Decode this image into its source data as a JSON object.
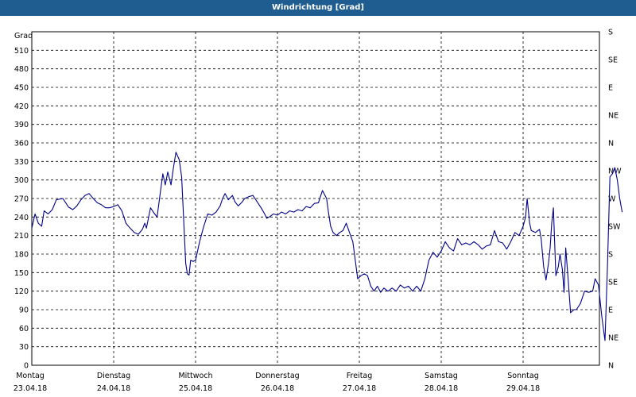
{
  "window": {
    "title": "Windrichtung [Grad]"
  },
  "chart_data": {
    "type": "line",
    "title": "Windrichtung [Grad]",
    "ylabel": "Grad",
    "ylim": [
      0,
      540
    ],
    "grid": true,
    "y_ticks": [
      0,
      30,
      60,
      90,
      120,
      150,
      180,
      210,
      240,
      270,
      300,
      330,
      360,
      390,
      420,
      450,
      480,
      510
    ],
    "right_ticks": [
      {
        "deg": 0,
        "label": "N"
      },
      {
        "deg": 45,
        "label": "NE"
      },
      {
        "deg": 90,
        "label": "E"
      },
      {
        "deg": 135,
        "label": "SE"
      },
      {
        "deg": 180,
        "label": "S"
      },
      {
        "deg": 225,
        "label": "SW"
      },
      {
        "deg": 270,
        "label": "W"
      },
      {
        "deg": 315,
        "label": "NW"
      },
      {
        "deg": 360,
        "label": "N"
      },
      {
        "deg": 405,
        "label": "NE"
      },
      {
        "deg": 450,
        "label": "E"
      },
      {
        "deg": 495,
        "label": "SE"
      },
      {
        "deg": 540,
        "label": "S"
      }
    ],
    "x_ticks": [
      {
        "day": "Montag",
        "date": "23.04.18"
      },
      {
        "day": "Dienstag",
        "date": "24.04.18"
      },
      {
        "day": "Mittwoch",
        "date": "25.04.18"
      },
      {
        "day": "Donnerstag",
        "date": "26.04.18"
      },
      {
        "day": "Freitag",
        "date": "27.04.18"
      },
      {
        "day": "Samstag",
        "date": "28.04.18"
      },
      {
        "day": "Sonntag",
        "date": "29.04.18"
      }
    ],
    "series": [
      {
        "color": "#00008b",
        "points": [
          [
            0.0,
            222
          ],
          [
            0.04,
            245
          ],
          [
            0.08,
            230
          ],
          [
            0.12,
            225
          ],
          [
            0.15,
            250
          ],
          [
            0.2,
            245
          ],
          [
            0.25,
            252
          ],
          [
            0.3,
            268
          ],
          [
            0.38,
            270
          ],
          [
            0.45,
            256
          ],
          [
            0.5,
            252
          ],
          [
            0.55,
            258
          ],
          [
            0.6,
            268
          ],
          [
            0.65,
            275
          ],
          [
            0.7,
            278
          ],
          [
            0.75,
            270
          ],
          [
            0.8,
            263
          ],
          [
            0.85,
            260
          ],
          [
            0.9,
            255
          ],
          [
            0.95,
            255
          ],
          [
            1.0,
            257
          ],
          [
            1.05,
            260
          ],
          [
            1.1,
            250
          ],
          [
            1.15,
            230
          ],
          [
            1.2,
            222
          ],
          [
            1.25,
            215
          ],
          [
            1.3,
            212
          ],
          [
            1.35,
            220
          ],
          [
            1.38,
            230
          ],
          [
            1.4,
            222
          ],
          [
            1.45,
            255
          ],
          [
            1.5,
            245
          ],
          [
            1.53,
            240
          ],
          [
            1.57,
            280
          ],
          [
            1.6,
            310
          ],
          [
            1.63,
            292
          ],
          [
            1.66,
            313
          ],
          [
            1.7,
            292
          ],
          [
            1.73,
            320
          ],
          [
            1.76,
            345
          ],
          [
            1.8,
            333
          ],
          [
            1.83,
            305
          ],
          [
            1.86,
            220
          ],
          [
            1.88,
            165
          ],
          [
            1.9,
            148
          ],
          [
            1.92,
            146
          ],
          [
            1.94,
            170
          ],
          [
            1.97,
            168
          ],
          [
            2.0,
            170
          ],
          [
            2.05,
            200
          ],
          [
            2.1,
            225
          ],
          [
            2.15,
            245
          ],
          [
            2.2,
            243
          ],
          [
            2.25,
            248
          ],
          [
            2.3,
            258
          ],
          [
            2.33,
            270
          ],
          [
            2.36,
            278
          ],
          [
            2.4,
            268
          ],
          [
            2.45,
            275
          ],
          [
            2.48,
            265
          ],
          [
            2.52,
            258
          ],
          [
            2.56,
            263
          ],
          [
            2.6,
            270
          ],
          [
            2.65,
            273
          ],
          [
            2.7,
            275
          ],
          [
            2.75,
            265
          ],
          [
            2.8,
            255
          ],
          [
            2.84,
            246
          ],
          [
            2.87,
            238
          ],
          [
            2.9,
            240
          ],
          [
            2.95,
            245
          ],
          [
            3.0,
            243
          ],
          [
            3.05,
            248
          ],
          [
            3.1,
            245
          ],
          [
            3.15,
            250
          ],
          [
            3.2,
            248
          ],
          [
            3.25,
            252
          ],
          [
            3.3,
            250
          ],
          [
            3.35,
            257
          ],
          [
            3.4,
            255
          ],
          [
            3.45,
            262
          ],
          [
            3.5,
            263
          ],
          [
            3.55,
            283
          ],
          [
            3.6,
            270
          ],
          [
            3.62,
            250
          ],
          [
            3.65,
            225
          ],
          [
            3.68,
            215
          ],
          [
            3.72,
            210
          ],
          [
            3.76,
            215
          ],
          [
            3.8,
            218
          ],
          [
            3.84,
            230
          ],
          [
            3.88,
            215
          ],
          [
            3.92,
            200
          ],
          [
            3.95,
            170
          ],
          [
            3.98,
            140
          ],
          [
            4.02,
            145
          ],
          [
            4.06,
            148
          ],
          [
            4.1,
            145
          ],
          [
            4.14,
            128
          ],
          [
            4.18,
            120
          ],
          [
            4.22,
            128
          ],
          [
            4.26,
            118
          ],
          [
            4.3,
            125
          ],
          [
            4.35,
            120
          ],
          [
            4.4,
            125
          ],
          [
            4.45,
            120
          ],
          [
            4.5,
            130
          ],
          [
            4.55,
            125
          ],
          [
            4.6,
            128
          ],
          [
            4.65,
            120
          ],
          [
            4.7,
            128
          ],
          [
            4.75,
            120
          ],
          [
            4.8,
            140
          ],
          [
            4.85,
            170
          ],
          [
            4.9,
            183
          ],
          [
            4.95,
            175
          ],
          [
            5.0,
            185
          ],
          [
            5.05,
            200
          ],
          [
            5.1,
            190
          ],
          [
            5.15,
            185
          ],
          [
            5.2,
            205
          ],
          [
            5.25,
            195
          ],
          [
            5.3,
            198
          ],
          [
            5.35,
            195
          ],
          [
            5.4,
            200
          ],
          [
            5.45,
            195
          ],
          [
            5.5,
            188
          ],
          [
            5.55,
            193
          ],
          [
            5.6,
            195
          ],
          [
            5.65,
            218
          ],
          [
            5.7,
            200
          ],
          [
            5.75,
            198
          ],
          [
            5.8,
            188
          ],
          [
            5.85,
            200
          ],
          [
            5.9,
            215
          ],
          [
            5.95,
            210
          ],
          [
            6.0,
            225
          ],
          [
            6.03,
            240
          ],
          [
            6.05,
            270
          ],
          [
            6.08,
            230
          ],
          [
            6.1,
            218
          ],
          [
            6.15,
            215
          ],
          [
            6.2,
            220
          ],
          [
            6.22,
            205
          ],
          [
            6.25,
            160
          ],
          [
            6.28,
            138
          ],
          [
            6.31,
            165
          ],
          [
            6.33,
            190
          ],
          [
            6.35,
            230
          ],
          [
            6.37,
            255
          ],
          [
            6.4,
            145
          ],
          [
            6.43,
            160
          ],
          [
            6.45,
            180
          ],
          [
            6.48,
            155
          ],
          [
            6.5,
            118
          ],
          [
            6.52,
            190
          ],
          [
            6.55,
            140
          ],
          [
            6.58,
            85
          ],
          [
            6.62,
            90
          ],
          [
            6.65,
            90
          ],
          [
            6.7,
            100
          ],
          [
            6.75,
            120
          ],
          [
            6.8,
            118
          ],
          [
            6.85,
            120
          ],
          [
            6.88,
            140
          ],
          [
            6.92,
            130
          ],
          [
            6.96,
            80
          ],
          [
            6.98,
            60
          ],
          [
            7.0,
            40
          ],
          [
            7.03,
            160
          ],
          [
            7.06,
            305
          ],
          [
            7.09,
            310
          ],
          [
            7.12,
            320
          ],
          [
            7.15,
            300
          ],
          [
            7.18,
            270
          ],
          [
            7.21,
            248
          ]
        ]
      }
    ]
  }
}
